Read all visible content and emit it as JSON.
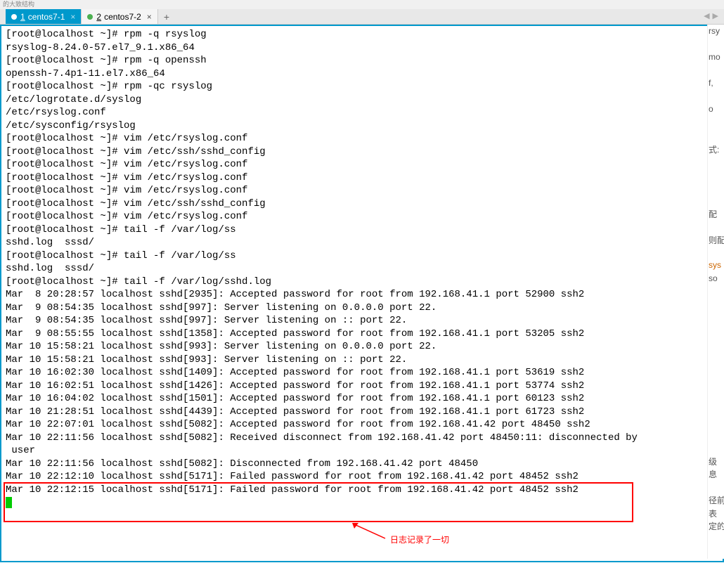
{
  "titlebar": "的大致结构",
  "tabs": [
    {
      "num": "1",
      "label": "centos7-1",
      "active": true
    },
    {
      "num": "2",
      "label": "centos7-2",
      "active": false
    }
  ],
  "terminal": {
    "lines": [
      "[root@localhost ~]# rpm -q rsyslog",
      "rsyslog-8.24.0-57.el7_9.1.x86_64",
      "[root@localhost ~]# rpm -q openssh",
      "openssh-7.4p1-11.el7.x86_64",
      "[root@localhost ~]# rpm -qc rsyslog",
      "/etc/logrotate.d/syslog",
      "/etc/rsyslog.conf",
      "/etc/sysconfig/rsyslog",
      "[root@localhost ~]# vim /etc/rsyslog.conf",
      "[root@localhost ~]# vim /etc/ssh/sshd_config",
      "[root@localhost ~]# vim /etc/rsyslog.conf",
      "[root@localhost ~]# vim /etc/rsyslog.conf",
      "[root@localhost ~]# vim /etc/rsyslog.conf",
      "[root@localhost ~]# vim /etc/ssh/sshd_config",
      "[root@localhost ~]# vim /etc/rsyslog.conf",
      "[root@localhost ~]# tail -f /var/log/ss",
      "sshd.log  sssd/",
      "[root@localhost ~]# tail -f /var/log/ss",
      "sshd.log  sssd/",
      "[root@localhost ~]# tail -f /var/log/sshd.log",
      "Mar  8 20:28:57 localhost sshd[2935]: Accepted password for root from 192.168.41.1 port 52900 ssh2",
      "Mar  9 08:54:35 localhost sshd[997]: Server listening on 0.0.0.0 port 22.",
      "Mar  9 08:54:35 localhost sshd[997]: Server listening on :: port 22.",
      "Mar  9 08:55:55 localhost sshd[1358]: Accepted password for root from 192.168.41.1 port 53205 ssh2",
      "Mar 10 15:58:21 localhost sshd[993]: Server listening on 0.0.0.0 port 22.",
      "Mar 10 15:58:21 localhost sshd[993]: Server listening on :: port 22.",
      "Mar 10 16:02:30 localhost sshd[1409]: Accepted password for root from 192.168.41.1 port 53619 ssh2",
      "Mar 10 16:02:51 localhost sshd[1426]: Accepted password for root from 192.168.41.1 port 53774 ssh2",
      "Mar 10 16:04:02 localhost sshd[1501]: Accepted password for root from 192.168.41.1 port 60123 ssh2",
      "Mar 10 21:28:51 localhost sshd[4439]: Accepted password for root from 192.168.41.1 port 61723 ssh2",
      "Mar 10 22:07:01 localhost sshd[5082]: Accepted password for root from 192.168.41.42 port 48450 ssh2",
      "Mar 10 22:11:56 localhost sshd[5082]: Received disconnect from 192.168.41.42 port 48450:11: disconnected by",
      " user",
      "Mar 10 22:11:56 localhost sshd[5082]: Disconnected from 192.168.41.42 port 48450",
      "Mar 10 22:12:10 localhost sshd[5171]: Failed password for root from 192.168.41.42 port 48452 ssh2",
      "Mar 10 22:12:15 localhost sshd[5171]: Failed password for root from 192.168.41.42 port 48452 ssh2"
    ]
  },
  "annotation": {
    "text": "日志记录了一切"
  },
  "side_fragments": [
    "rsy",
    "",
    "mo",
    "",
    "f,",
    "",
    "o",
    "",
    "",
    "式:",
    "",
    "",
    "",
    "",
    "配",
    "",
    "则配",
    "",
    "sys",
    "so",
    "",
    "",
    "",
    "",
    "",
    "",
    "",
    "",
    "",
    "",
    "",
    "",
    "",
    "级",
    "息",
    "",
    "径前",
    "  表",
    "定的"
  ]
}
